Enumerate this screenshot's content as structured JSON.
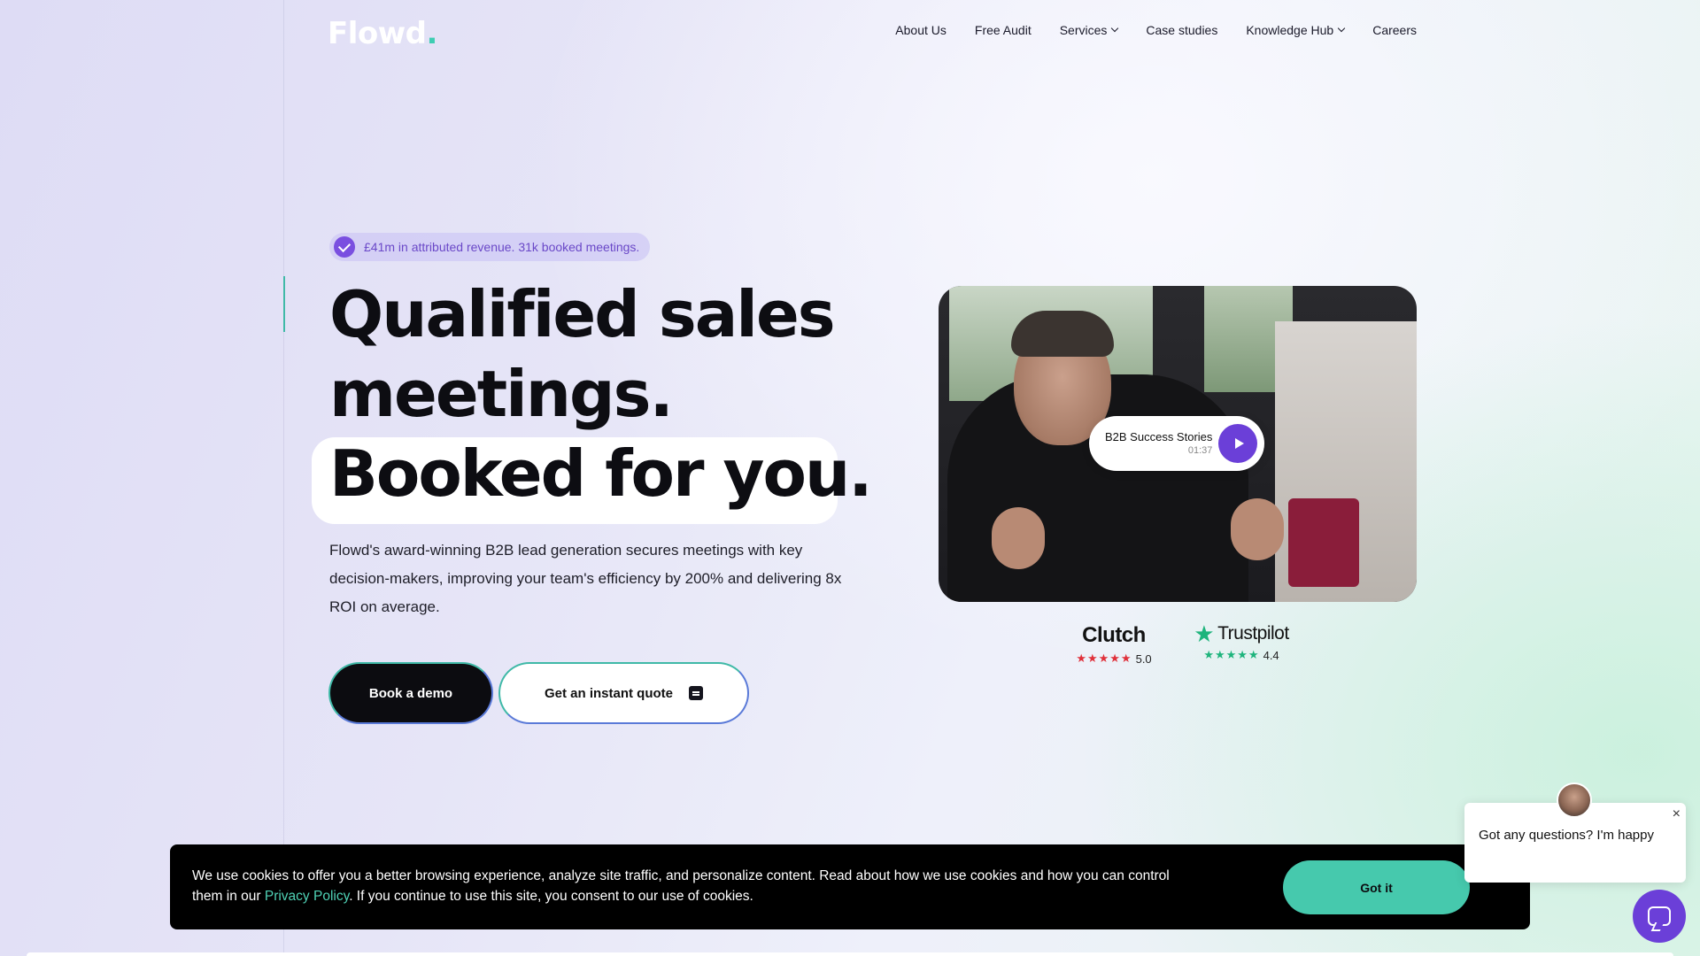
{
  "header": {
    "logo": "Flowd",
    "logo_dot": ".",
    "nav": [
      {
        "label": "About Us"
      },
      {
        "label": "Free Audit"
      },
      {
        "label": "Services"
      },
      {
        "label": "Case studies"
      },
      {
        "label": "Knowledge Hub"
      },
      {
        "label": "Careers"
      }
    ]
  },
  "hero": {
    "badge": "£41m in attributed revenue. 31k booked meetings.",
    "headline_line1": "Qualified sales",
    "headline_line2": "meetings.",
    "headline_line3": "Booked for you.",
    "description": "Flowd's award-winning B2B lead generation secures meetings with key decision-makers, improving your team's efficiency by 200% and delivering 8x ROI on average.",
    "primary_button": "Book a demo",
    "secondary_button": "Get an instant quote"
  },
  "video": {
    "title": "B2B Success Stories",
    "duration": "01:37"
  },
  "ratings": {
    "clutch": {
      "brand": "Clutch",
      "score": "5.0",
      "stars": "★★★★★"
    },
    "trustpilot": {
      "brand": "Trustpilot",
      "score": "4.4",
      "stars": "★★★★★"
    }
  },
  "cookie": {
    "text_before": "We use cookies to offer you a better browsing experience, analyze site traffic, and personalize content. Read about how we use cookies and how you can control them in our ",
    "link": "Privacy Policy",
    "text_after": ". If you continue to use this site, you consent to our use of cookies.",
    "button": "Got it"
  },
  "chat": {
    "message": "Got any questions? I'm happy",
    "close": "×"
  },
  "colors": {
    "accent_teal": "#46c9ad",
    "accent_purple": "#6b3fd8",
    "clutch_red": "#e0303a",
    "trustpilot_green": "#1eb47c"
  }
}
